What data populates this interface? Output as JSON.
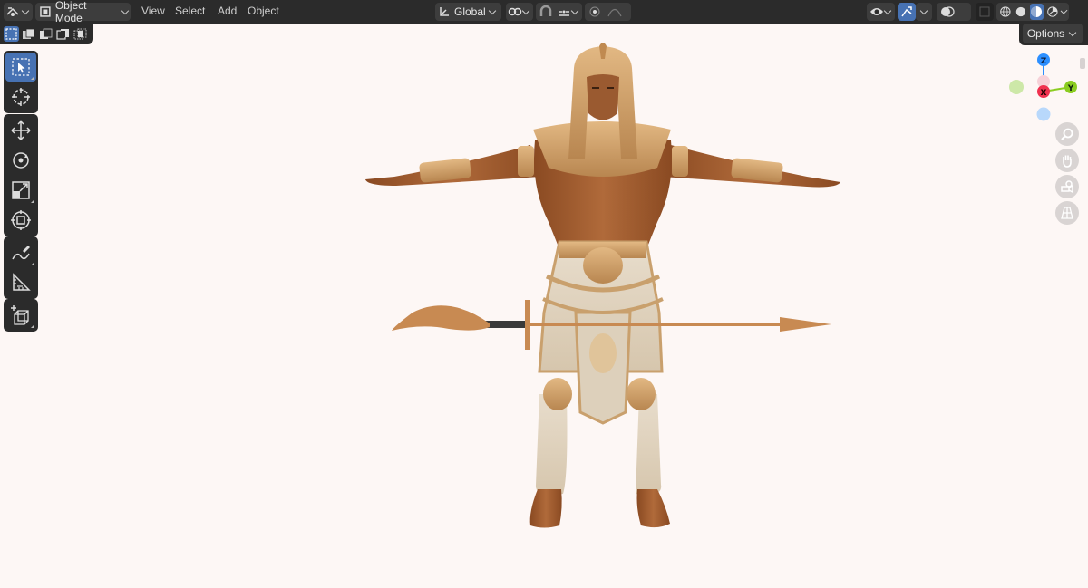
{
  "header": {
    "mode_label": "Object Mode",
    "menus": [
      "View",
      "Select",
      "Add",
      "Object"
    ],
    "orientation_label": "Global",
    "options_label": "Options"
  },
  "gizmo": {
    "z_label": "Z",
    "x_label": "X",
    "y_label": "Y",
    "colors": {
      "x": "#f0304f",
      "y": "#8bcc21",
      "z": "#2c8fff",
      "neg_y": "#cde8a8",
      "neg_z": "#b8d8fb"
    }
  },
  "tools": {
    "groups": [
      [
        "select-box-icon",
        "cursor-icon"
      ],
      [
        "move-icon",
        "rotate-icon",
        "scale-icon",
        "transform-icon"
      ],
      [
        "annotate-icon",
        "measure-icon"
      ],
      [
        "add-cube-icon"
      ]
    ]
  },
  "colors": {
    "accent": "#4772b3",
    "header_bg": "#2b2b2b",
    "viewport_bg": "#fdf7f5"
  }
}
